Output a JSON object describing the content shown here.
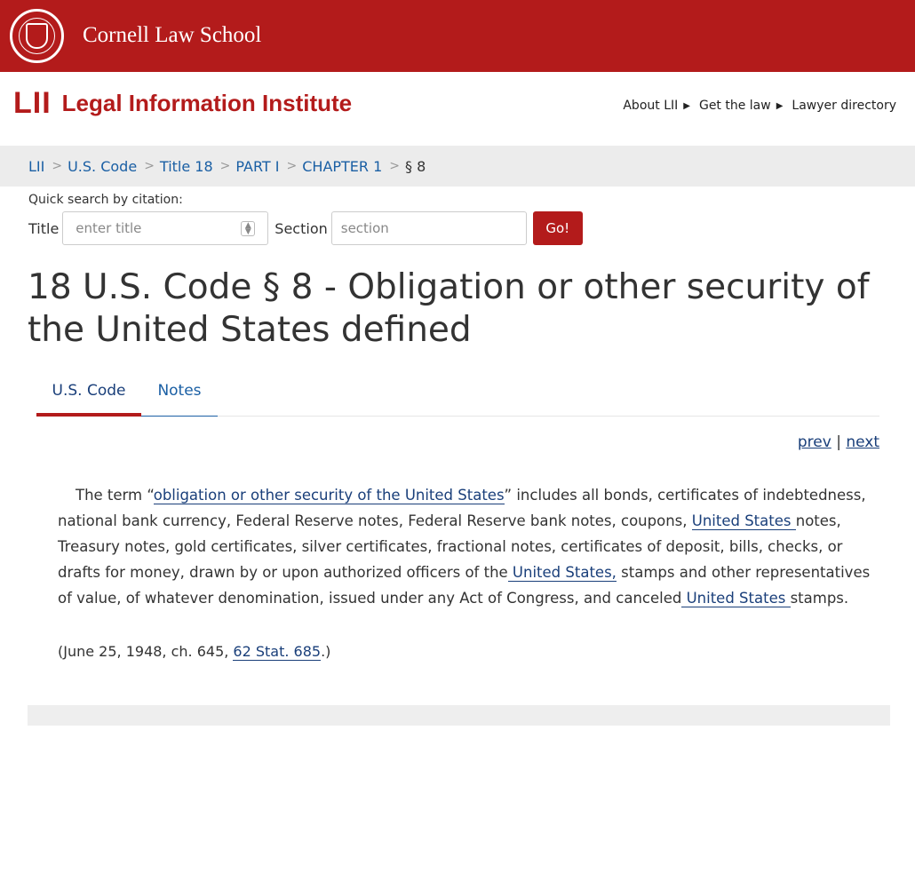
{
  "header": {
    "institution": "Cornell Law School",
    "brand_mark": "LII",
    "brand_name": "Legal Information Institute",
    "nav": [
      "About LII",
      "Get the law",
      "Lawyer directory"
    ]
  },
  "breadcrumb": [
    "LII",
    "U.S. Code",
    "Title 18",
    "PART I",
    "CHAPTER 1",
    "§ 8"
  ],
  "quick_search": {
    "label": "Quick search by citation:",
    "title_label": "Title",
    "title_placeholder": "enter title",
    "section_label": "Section",
    "section_placeholder": "section",
    "go_label": "Go!"
  },
  "page_title": "18 U.S. Code § 8 - Obligation or other security of the United States defined",
  "tabs": [
    "U.S. Code",
    "Notes"
  ],
  "pager": {
    "prev": "prev",
    "sep": "|",
    "next": "next"
  },
  "body": {
    "p1_a": "The term “",
    "p1_link": "obligation or other security of the United States",
    "p1_b": "” includes all bonds, certificates of indebtedness, national bank currency, Federal Reserve notes, Federal Reserve bank notes, coupons, ",
    "p1_link2": "United States ",
    "p1_c": "notes, Treasury notes, gold certificates, silver certificates, fractional notes, certificates of deposit, bills, checks, or drafts for money, drawn by or upon authorized officers of the",
    "p1_link3": " United States,",
    "p1_d": " stamps and other representatives of value, of whatever denomination, issued under any Act of Congress, and canceled",
    "p1_link4": " United States ",
    "p1_e": "stamps."
  },
  "source": {
    "a": "(June 25, 1948, ch. 645, ",
    "link": "62 Stat. 685",
    "b": ".)"
  },
  "colors": {
    "brand_red": "#b31b1b",
    "link_blue": "#1a5fa4",
    "link_dark": "#1a3f7a"
  }
}
